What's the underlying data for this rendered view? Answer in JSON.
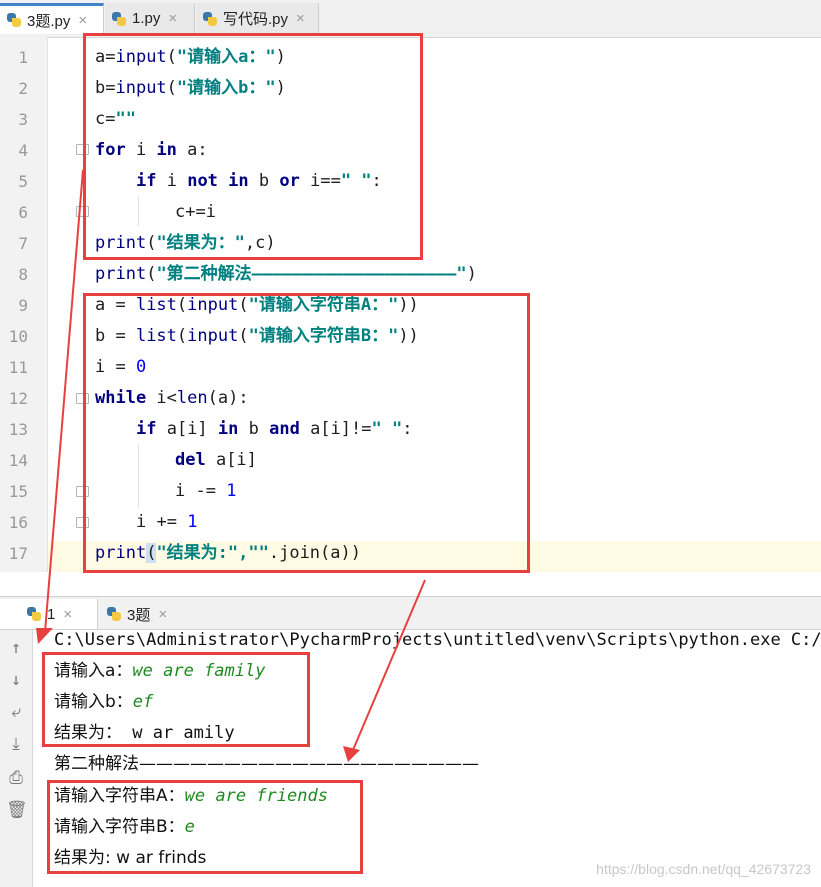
{
  "editor_tabs": [
    {
      "label": "3题.py",
      "active": true
    },
    {
      "label": "1.py",
      "active": false
    },
    {
      "label": "写代码.py",
      "active": false
    }
  ],
  "line_numbers": [
    "1",
    "2",
    "3",
    "4",
    "5",
    "6",
    "7",
    "8",
    "9",
    "10",
    "11",
    "12",
    "13",
    "14",
    "15",
    "16",
    "17"
  ],
  "code": {
    "l1": {
      "a": "a=",
      "b": "input",
      "c": "(",
      "s": "\"请输入a：\"",
      "e": ")"
    },
    "l2": {
      "a": "b=",
      "b": "input",
      "c": "(",
      "s": "\"请输入b：\"",
      "e": ")"
    },
    "l3": {
      "a": "c=",
      "s": "\"\""
    },
    "l4": {
      "k1": "for",
      "m": " i ",
      "k2": "in",
      "e": " a:"
    },
    "l5": {
      "k1": "if",
      "m1": " i ",
      "k2": "not",
      "m2": " ",
      "k3": "in",
      "m3": " b ",
      "k4": "or",
      "m4": " i==",
      "s": "\" \"",
      "e": ":"
    },
    "l6": {
      "t": "c+=i"
    },
    "l7": {
      "b": "print",
      "c": "(",
      "s": "\"结果为：\"",
      "e": ",c)"
    },
    "l8": {
      "b": "print",
      "c": "(",
      "s": "\"第二种解法————————————————————\"",
      "e": ")"
    },
    "l9": {
      "a": "a = ",
      "b1": "list",
      "c1": "(",
      "b2": "input",
      "c2": "(",
      "s": "\"请输入字符串A：\"",
      "e": "))"
    },
    "l10": {
      "a": "b = ",
      "b1": "list",
      "c1": "(",
      "b2": "input",
      "c2": "(",
      "s": "\"请输入字符串B：\"",
      "e": "))"
    },
    "l11": {
      "a": "i = ",
      "n": "0"
    },
    "l12": {
      "k": "while",
      "m": " i<",
      "b": "len",
      "e": "(a):"
    },
    "l13": {
      "k1": "if",
      "m1": " a[i] ",
      "k2": "in",
      "m2": " b ",
      "k3": "and",
      "m3": " a[i]!=",
      "s": "\" \"",
      "e": ":"
    },
    "l14": {
      "k": "del",
      "e": " a[i]"
    },
    "l15": {
      "a": "i -= ",
      "n": "1"
    },
    "l16": {
      "a": "i += ",
      "n": "1"
    },
    "l17": {
      "b": "print",
      "c": "(",
      "s": "\"结果为:\",\"\"",
      "e": ".join(a))"
    }
  },
  "run_tabs": [
    {
      "label": "1",
      "active": true
    },
    {
      "label": "3题",
      "active": false
    }
  ],
  "sidebar_icons": [
    "arrow-up-icon",
    "arrow-down-icon",
    "soft-wrap-icon",
    "scroll-to-end-icon",
    "print-icon",
    "trash-icon"
  ],
  "console": {
    "command": "C:\\Users\\Administrator\\PycharmProjects\\untitled\\venv\\Scripts\\python.exe C:/Us",
    "p1_prompt": "请输入a：",
    "p1_input": "we are family",
    "p2_prompt": "请输入b：",
    "p2_input": "ef",
    "r1_label": "结果为：",
    "r1_value": " w ar amily",
    "sep": "第二种解法————————————————————",
    "p3_prompt": "请输入字符串A：",
    "p3_input": "we are friends",
    "p4_prompt": "请输入字符串B：",
    "p4_input": "e",
    "r2": "结果为: w ar frinds"
  },
  "watermark": "https://blog.csdn.net/qq_42673723",
  "colors": {
    "annotation_red": "#e8403f",
    "keyword": "#000080",
    "string": "#008080",
    "number": "#0000ff",
    "input_green": "#1f8a1f",
    "tab_accent": "#4083c9"
  }
}
